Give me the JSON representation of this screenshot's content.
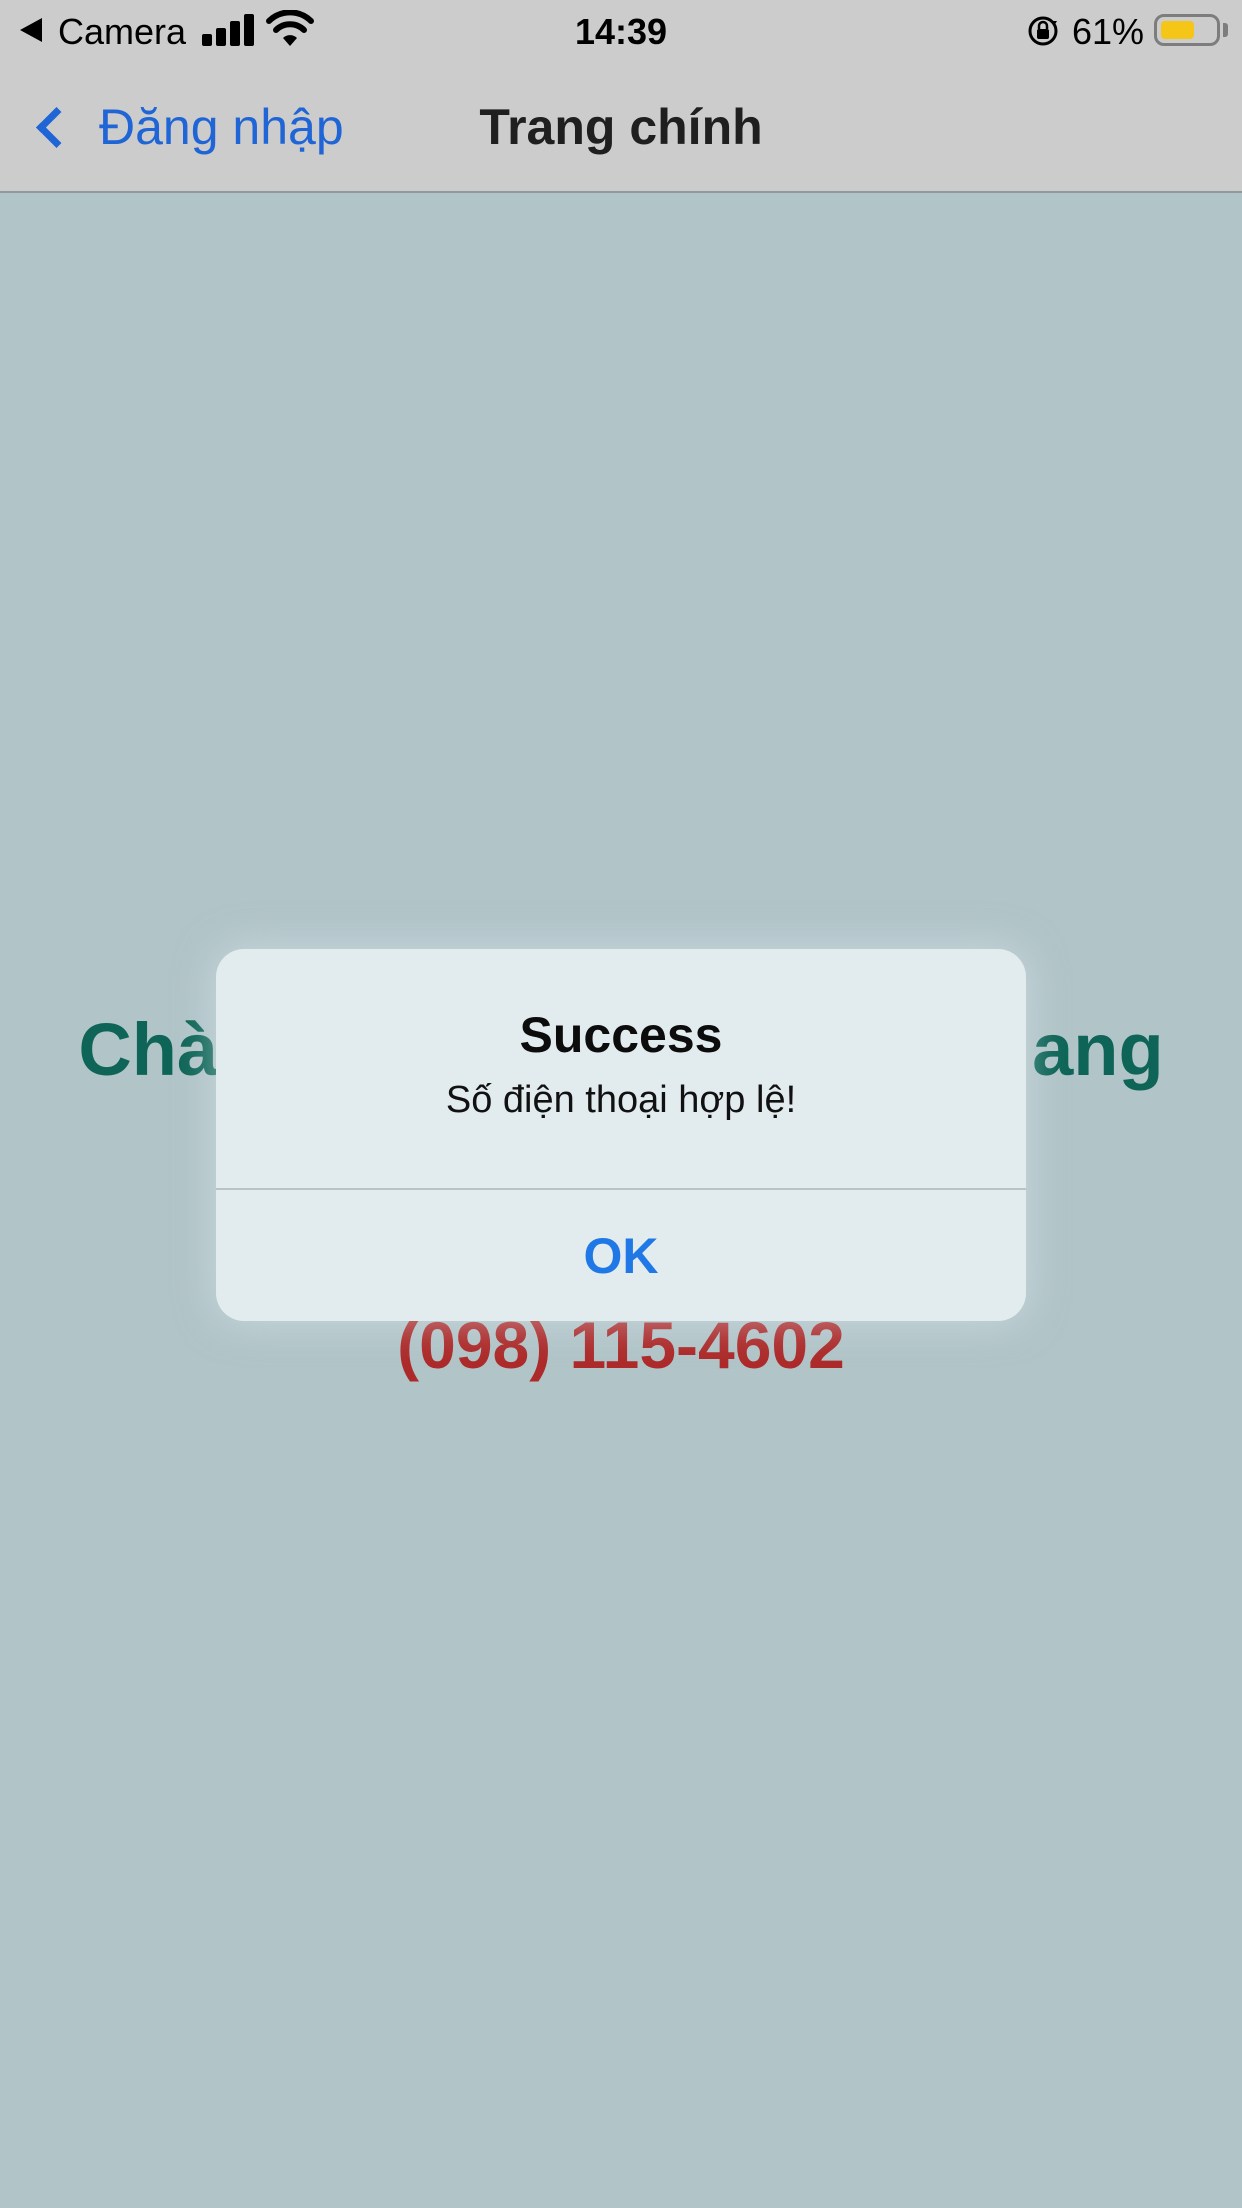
{
  "status_bar": {
    "back_app": "Camera",
    "time": "14:39",
    "battery_percent": "61%",
    "battery_level": 0.61,
    "signal_bars": 4,
    "icons": [
      "back-caret-icon",
      "cellular-signal-icon",
      "wifi-icon",
      "orientation-lock-icon",
      "battery-icon"
    ],
    "battery_color": "#f5c518"
  },
  "nav": {
    "back_label": "Đăng nhập",
    "title": "Trang chính",
    "accent_color": "#1f65d6"
  },
  "main": {
    "welcome_visible_left": "Chà",
    "welcome_visible_right": "ang",
    "phone": "(098) 115-4602",
    "welcome_color": "#0e6557",
    "phone_color": "#ad2a2a"
  },
  "alert": {
    "title": "Success",
    "message": "Số điện thoại hợp lệ!",
    "ok_label": "OK",
    "ok_color": "#1f78e6"
  }
}
